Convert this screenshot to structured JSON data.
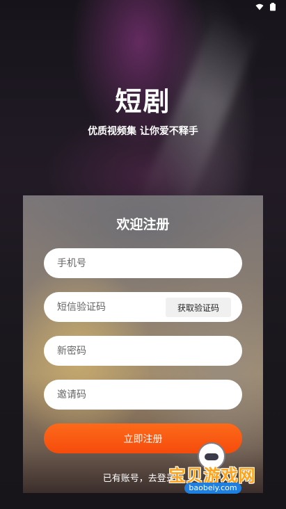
{
  "status_bar": {
    "time": "",
    "wifi_icon": "wifi-icon",
    "battery_icon": "battery-icon"
  },
  "app": {
    "title": "短剧",
    "subtitle": "优质视频集 让你爱不释手"
  },
  "register": {
    "title": "欢迎注册",
    "phone_placeholder": "手机号",
    "sms_code_placeholder": "短信验证码",
    "get_code_label": "获取验证码",
    "new_password_placeholder": "新密码",
    "invite_code_placeholder": "邀请码",
    "submit_label": "立即注册",
    "login_link": "已有账号，去登录",
    "login_arrow": "»"
  },
  "colors": {
    "submit_gradient_start": "#fc6a1a",
    "submit_gradient_end": "#f64b0c",
    "field_background": "#ffffff"
  },
  "watermark": {
    "text": "宝贝游戏网",
    "domain": "baobeiy.com"
  }
}
